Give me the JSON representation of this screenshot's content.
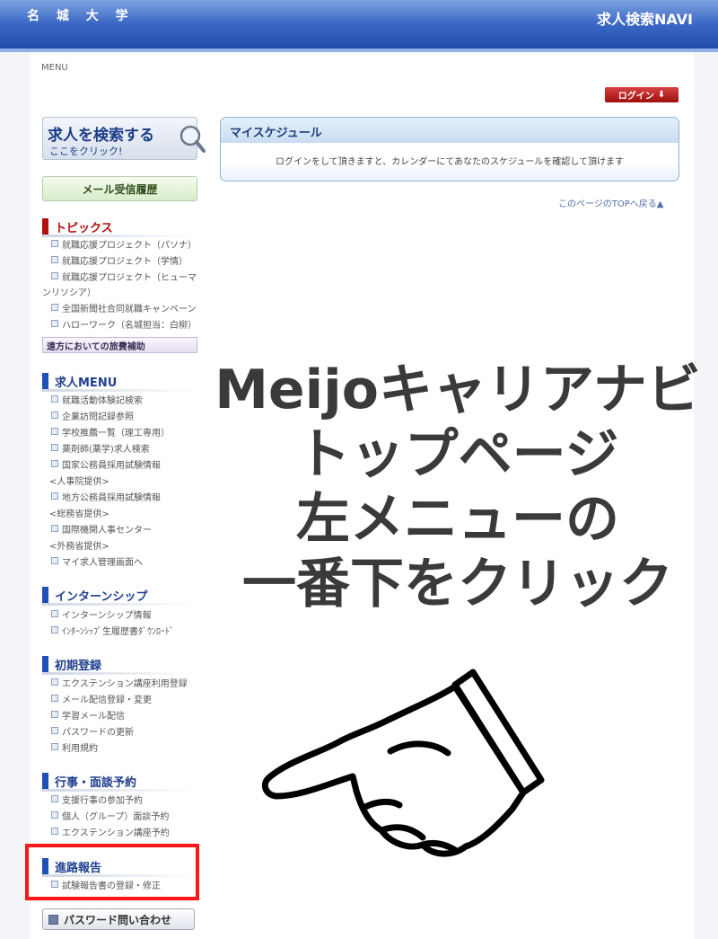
{
  "header": {
    "university": "名 城 大 学",
    "site_title": "求人検索NAVI"
  },
  "menu_label": "MENU",
  "login": {
    "label": "ログイン",
    "arrow": "⬇"
  },
  "search_banner": {
    "line1": "求人を検索する",
    "line2": "ここをクリック!"
  },
  "mail_history": {
    "label": "メール受信履歴"
  },
  "sections": {
    "topics": {
      "title": "トピックス",
      "color": "#b01010",
      "items": [
        "就職応援プロジェクト（パソナ）",
        "就職応援プロジェクト（学情）",
        "就職応援プロジェクト（ヒューマ",
        "ンリソシア）",
        "全国新聞社合同就職キャンペーン",
        "ハローワーク（名城担当：白柳）"
      ]
    },
    "travel": {
      "label": "遠方においての旅費補助"
    },
    "job_menu": {
      "title": "求人MENU",
      "color": "#1f4fb5",
      "items": [
        "就職活動体験記検索",
        "企業訪問記録参照",
        "学校推薦一覧（理工専用）",
        "薬剤師(薬学)求人検索",
        "国家公務員採用試験情報",
        "<人事院提供>",
        "地方公務員採用試験情報",
        "<総務省提供>",
        "国際機関人事センター",
        "<外務省提供>",
        "マイ求人管理画面へ"
      ]
    },
    "internship": {
      "title": "インターンシップ",
      "color": "#1f4fb5",
      "items": [
        "インターンシップ情報",
        "ｲﾝﾀｰﾝｼｯﾌﾟ生履歴書ﾀﾞｳﾝﾛｰﾄﾞ"
      ]
    },
    "registration": {
      "title": "初期登録",
      "color": "#1f4fb5",
      "items": [
        "エクステンション講座利用登録",
        "メール配信登録・変更",
        "学習メール配信",
        "パスワードの更新",
        "利用規約"
      ]
    },
    "events": {
      "title": "行事・面談予約",
      "color": "#1f4fb5",
      "items": [
        "支援行事の参加予約",
        "個人（グループ）面談予約",
        "エクステンション講座予約"
      ]
    },
    "career_report": {
      "title": "進路報告",
      "color": "#1f4fb5",
      "items": [
        "試験報告書の登録・修正"
      ]
    }
  },
  "password_inquiry": {
    "label": "パスワード問い合わせ"
  },
  "schedule": {
    "title": "マイスケジュール",
    "message": "ログインをして頂きますと、カレンダーにてあなたのスケジュールを確認して頂けます"
  },
  "top_link": "このページのTOPへ戻る▲",
  "overlay": {
    "line1": "Meijoキャリアナビ",
    "line2": "トップページ",
    "line3": "左メニューの",
    "line4": "一番下をクリック"
  },
  "icons": {
    "search": "magnifier-icon",
    "pointer": "pointing-hand-icon"
  },
  "highlight_color": "#ff1616"
}
